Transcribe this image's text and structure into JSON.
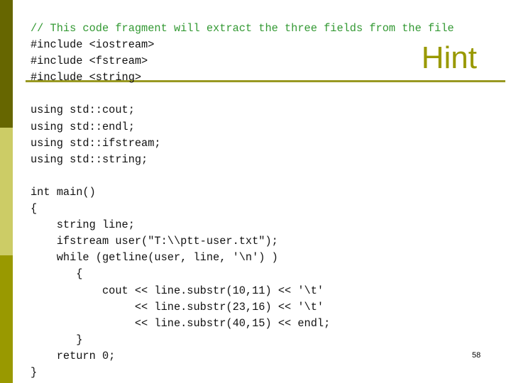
{
  "slide": {
    "title": "Hint",
    "page_number": "58",
    "accent_color": "#999900",
    "sidebar_colors": [
      "#666600",
      "#cccc66",
      "#999900"
    ]
  },
  "code": {
    "lines": [
      "// This code fragment will extract the three fields from the file",
      "#include <iostream>",
      "#include <fstream>",
      "#include <string>",
      "",
      "using std::cout;",
      "using std::endl;",
      "using std::ifstream;",
      "using std::string;",
      "",
      "int main()",
      "{",
      "    string line;",
      "    ifstream user(\"T:\\\\ptt-user.txt\");",
      "    while (getline(user, line, '\\n') )",
      "       {",
      "           cout << line.substr(10,11) << '\\t'",
      "                << line.substr(23,16) << '\\t'",
      "                << line.substr(40,15) << endl;",
      "       }",
      "    return 0;",
      "}"
    ]
  }
}
